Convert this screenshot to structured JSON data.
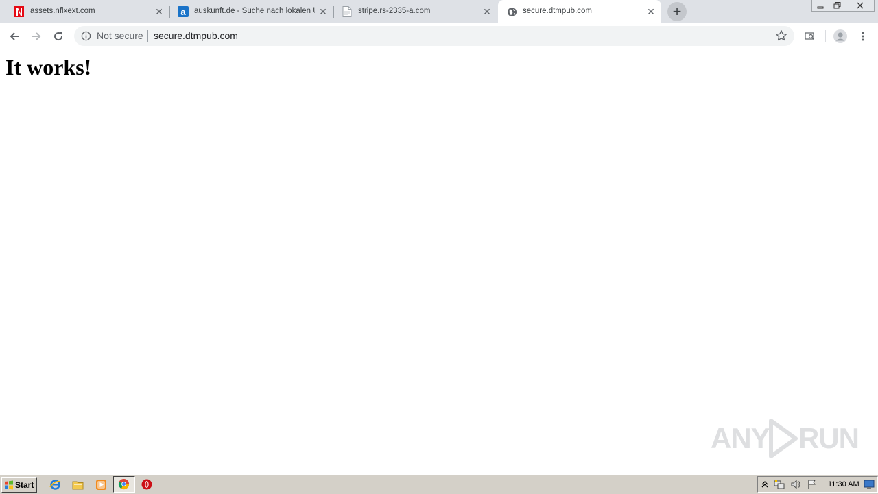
{
  "browser": {
    "tabs": [
      {
        "title": "assets.nflxext.com",
        "favicon": "netflix-icon",
        "active": false
      },
      {
        "title": "auskunft.de - Suche nach lokalen Un",
        "favicon": "auskunft-icon",
        "active": false
      },
      {
        "title": "stripe.rs-2335-a.com",
        "favicon": "document-icon",
        "active": false
      },
      {
        "title": "secure.dtmpub.com",
        "favicon": "globe-icon",
        "active": true
      }
    ],
    "new_tab_label": "+",
    "omnibox": {
      "security_text": "Not secure",
      "url": "secure.dtmpub.com"
    }
  },
  "page": {
    "heading": "It works!"
  },
  "watermark": {
    "left": "ANY",
    "right": "RUN"
  },
  "taskbar": {
    "start_label": "Start",
    "clock": "11:30 AM"
  },
  "colors": {
    "tabstrip_bg": "#dee1e6",
    "netflix_red": "#e50914",
    "auskunft_blue": "#1a73c8",
    "taskbar_bg": "#d4d0c8"
  }
}
